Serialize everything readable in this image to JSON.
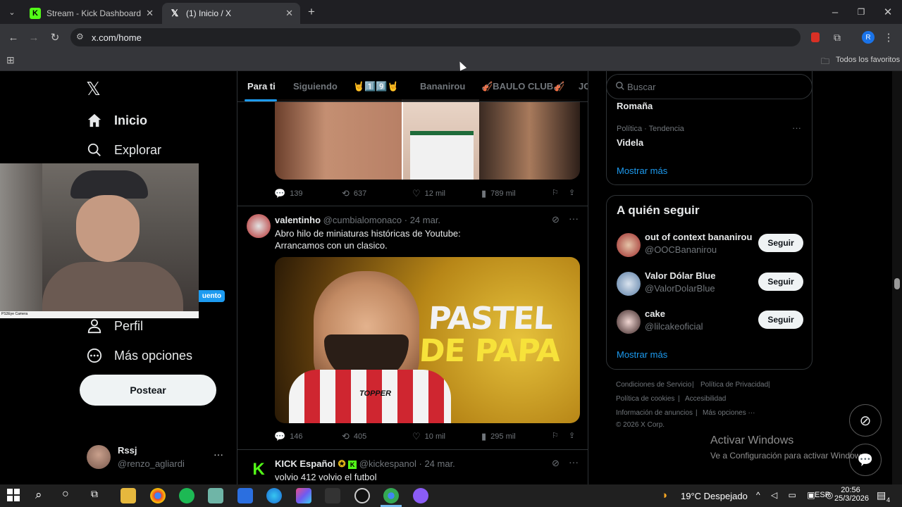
{
  "browser": {
    "tabs": [
      {
        "title": "Stream - Kick Dashboard",
        "icon": "kick-icon"
      },
      {
        "title": "(1) Inicio / X",
        "icon": "x-icon"
      }
    ],
    "url": "x.com/home",
    "bookmarks_label": "Todos los favoritos"
  },
  "sidebar": {
    "items": [
      {
        "label": "Inicio"
      },
      {
        "label": "Explorar"
      },
      {
        "label": "Perfil"
      },
      {
        "label": "Más opciones"
      }
    ],
    "badge_partial": "uento",
    "post_button": "Postear",
    "webcam_caption": "PS3Eye Camera",
    "account": {
      "name": "Rssj",
      "handle": "@renzo_agliardi"
    }
  },
  "timeline": {
    "tabs": [
      "Para ti",
      "Siguiendo",
      "🤘1️⃣9️⃣🤘",
      "Bananirou",
      "🎻BAULO CLUB🎻",
      "JO"
    ],
    "tweet1_stats": {
      "replies": "139",
      "reposts": "637",
      "likes": "12 mil",
      "views": "789 mil"
    },
    "tweet2": {
      "name": "valentinho",
      "handle": "@cumbialomonaco",
      "date": "· 24 mar.",
      "text_line1": "Abro hilo de miniaturas históricas de Youtube:",
      "text_line2": "Arrancamos con un clasico.",
      "image_text_1": "PASTEL",
      "image_text_2": "DE PAPA",
      "shirt_text": "TOPPER",
      "stats": {
        "replies": "146",
        "reposts": "405",
        "likes": "10 mil",
        "views": "295 mil"
      }
    },
    "tweet3": {
      "name": "KICK Español",
      "handle": "@kickespanol",
      "date": "· 24 mar.",
      "text": "volvio 412 volvio el futbol"
    }
  },
  "right": {
    "search_placeholder": "Buscar",
    "trend_top": "Romaña",
    "trend_category": "Política · Tendencia",
    "trend_name": "Videla",
    "show_more": "Mostrar más",
    "who_to_follow": "A quién seguir",
    "suggestions": [
      {
        "name": "out of context bananirou",
        "handle": "@OOCBananirou",
        "button": "Seguir"
      },
      {
        "name": "Valor Dólar Blue",
        "handle": "@ValorDolarBlue",
        "button": "Seguir"
      },
      {
        "name": "cake",
        "handle": "@lilcakeoficial",
        "button": "Seguir"
      }
    ],
    "show_more_2": "Mostrar más",
    "footer": {
      "terms": "Condiciones de Servicio",
      "privacy": "Política de Privacidad",
      "cookies": "Política de cookies",
      "accessibility": "Accesibilidad",
      "ads": "Información de anuncios",
      "more": "Más opciones ···",
      "copyright": "© 2026 X Corp."
    }
  },
  "watermark": {
    "line1": "Activar Windows",
    "line2": "Ve a Configuración para activar Windows."
  },
  "taskbar": {
    "weather": "19°C  Despejado",
    "lang": "ESP",
    "time": "20:56",
    "date": "25/3/2026",
    "notif_count": "4"
  },
  "colors": {
    "accent": "#1d9bf0",
    "bg": "#000000",
    "kick": "#53fc18"
  }
}
